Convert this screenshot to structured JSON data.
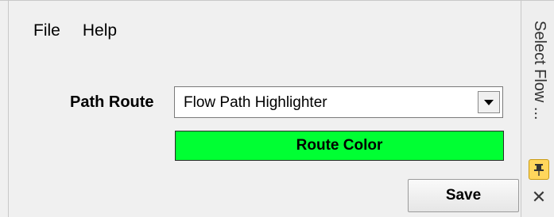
{
  "menu": {
    "items": [
      "File",
      "Help"
    ]
  },
  "form": {
    "path_route_label": "Path Route",
    "path_route_value": "Flow Path Highlighter",
    "route_color_label": "Route Color",
    "route_color_value": "#00ff33",
    "save_label": "Save"
  },
  "side_panel": {
    "title": "Select Flow ...",
    "pin_icon": "pin-icon",
    "close_icon": "close-icon"
  }
}
